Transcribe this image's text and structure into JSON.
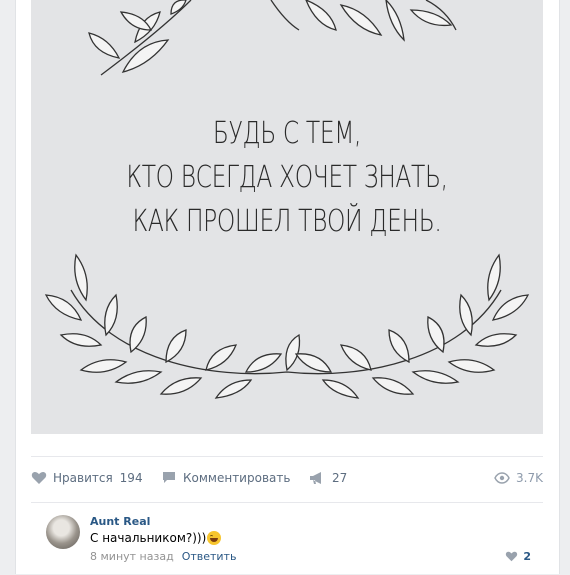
{
  "post": {
    "image": {
      "quote_lines": [
        "БУДЬ С ТЕМ,",
        "КТО ВСЕГДА ХОЧЕТ ЗНАТЬ,",
        "КАК ПРОШЕЛ ТВОЙ ДЕНЬ."
      ]
    },
    "actions": {
      "like_label": "Нравится",
      "like_count": "194",
      "comment_label": "Комментировать",
      "share_count": "27",
      "views_count": "3.7K"
    }
  },
  "comment": {
    "author": "Aunt Real",
    "text": "С начальником?)))",
    "time": "8 минут назад",
    "reply_label": "Ответить",
    "like_count": "2"
  },
  "colors": {
    "link": "#2a5885",
    "icon": "#8d9aab",
    "background": "#edeef0"
  }
}
